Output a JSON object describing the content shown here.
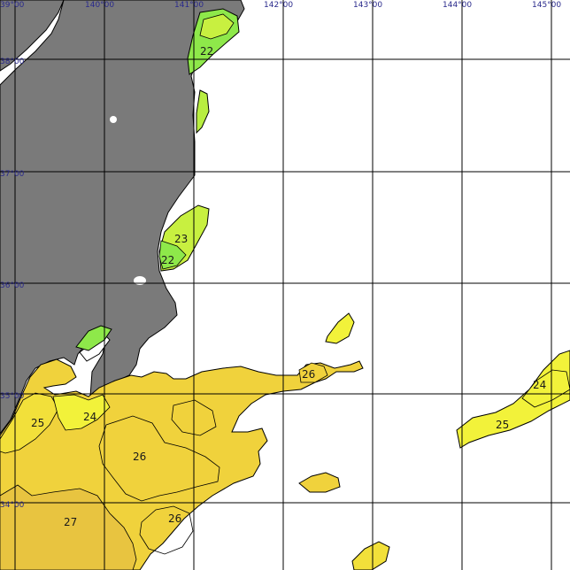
{
  "lon_labels": [
    "39°00",
    "140°00",
    "141°00",
    "142°00",
    "143°00",
    "144°00",
    "145°00"
  ],
  "lat_labels": [
    "38°00",
    "37°00",
    "36°00",
    "35°00",
    "34°00"
  ],
  "contour_labels": [
    "22",
    "23",
    "22",
    "26",
    "24",
    "25",
    "24",
    "25",
    "26",
    "27",
    "26"
  ],
  "colors": {
    "land": "#7a7a7a",
    "grid": "#000000",
    "sst_22": "#8ee84a",
    "sst_23": "#c8f040",
    "sst_24": "#f2f23a",
    "sst_25": "#f2e03a",
    "sst_26": "#f0d23c",
    "sst_27": "#e8c440",
    "tick_text": "#2a2a8c"
  }
}
